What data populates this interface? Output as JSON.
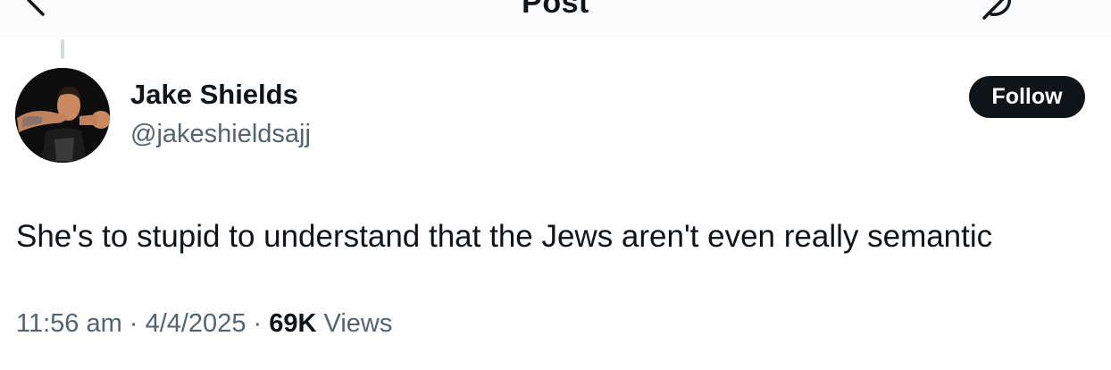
{
  "header": {
    "title": "Post",
    "back_icon": "back-arrow-icon",
    "grok_icon": "grok-icon"
  },
  "author": {
    "display_name": "Jake Shields",
    "handle": "@jakeshieldsajj",
    "avatar": "avatar-photo"
  },
  "actions": {
    "follow_label": "Follow"
  },
  "post": {
    "text": "She's to stupid to understand that the Jews aren't even really semantic"
  },
  "meta": {
    "time": "11:56 am",
    "separator": "·",
    "date": "4/4/2025",
    "views_count": "69K",
    "views_label": "Views"
  },
  "colors": {
    "text_primary": "#0f1419",
    "text_secondary": "#536471",
    "follow_bg": "#0f1419",
    "thread_line": "#cfd9de"
  }
}
